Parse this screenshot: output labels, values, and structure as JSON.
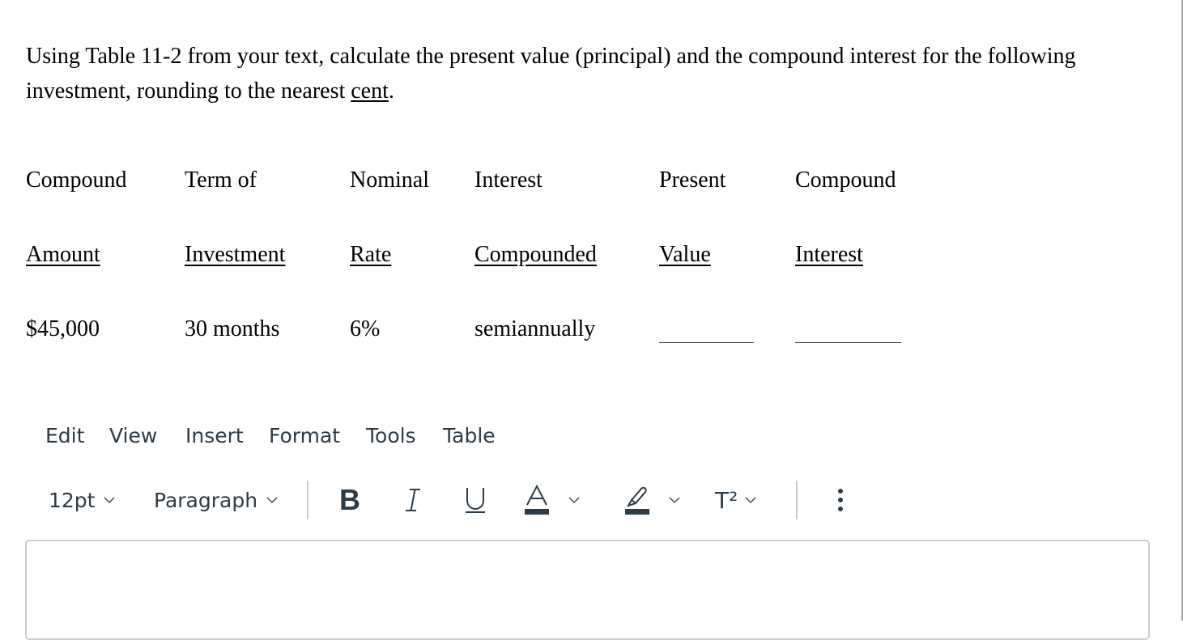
{
  "question": {
    "text_before": "Using Table 11-2 from your text, calculate the present value (principal) and the compound interest for the following investment, rounding to the nearest ",
    "underlined_word": "cent",
    "text_after": "."
  },
  "table": {
    "header_row_1": [
      "Compound",
      "Term of",
      "Nominal",
      "Interest",
      "Present",
      "Compound"
    ],
    "header_row_2": [
      "Amount",
      "Investment",
      "Rate",
      "Compounded",
      "Value",
      "Interest"
    ],
    "data_row": {
      "compound_amount": "$45,000",
      "term_of_investment": "30 months",
      "nominal_rate": "6%",
      "interest_compounded": "semiannually",
      "present_value": "",
      "compound_interest": ""
    }
  },
  "editor": {
    "menu": [
      "Edit",
      "View",
      "Insert",
      "Format",
      "Tools",
      "Table"
    ],
    "toolbar": {
      "font_size": "12pt",
      "block_format": "Paragraph",
      "bold_label": "B",
      "italic_label": "I",
      "underline_label": "U",
      "text_color_label": "A",
      "superscript_label": "T²",
      "text_color_swatch": "#2d3b45",
      "highlight_swatch": "#2d3b45"
    },
    "content": ""
  }
}
